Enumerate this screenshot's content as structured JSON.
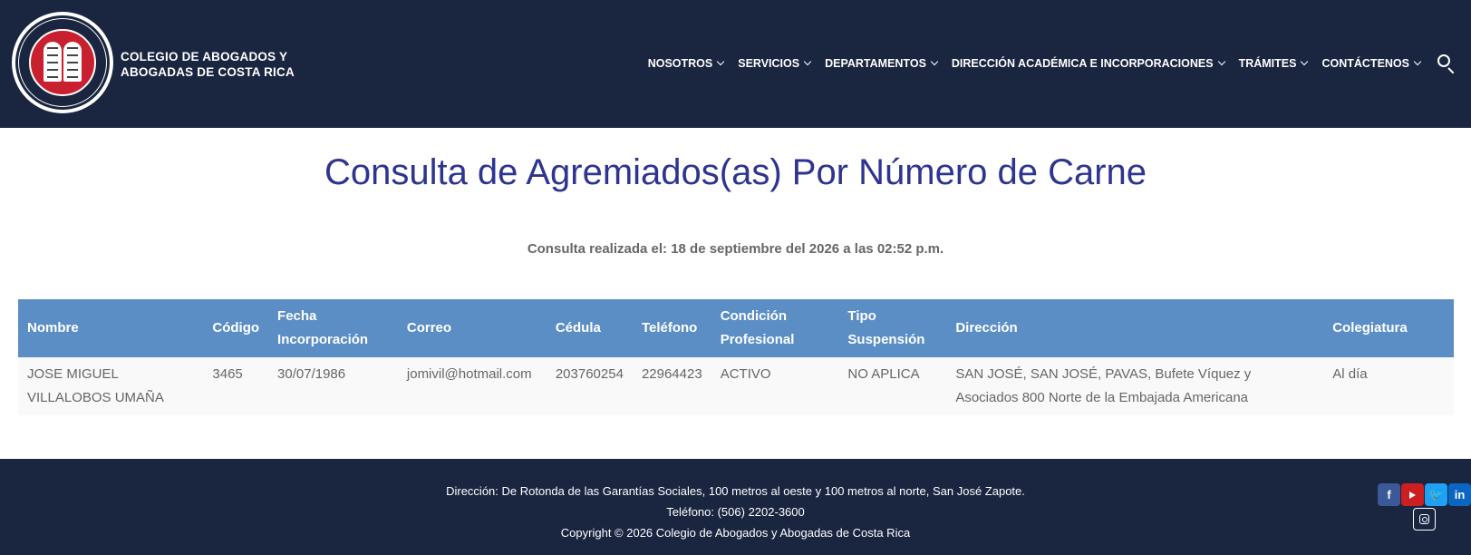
{
  "header": {
    "brand_line1": "COLEGIO DE ABOGADOS Y",
    "brand_line2": "ABOGADAS DE COSTA RICA",
    "logo_icon": "colegio-abogados-seal",
    "nav": [
      {
        "label": "NOSOTROS"
      },
      {
        "label": "SERVICIOS"
      },
      {
        "label": "DEPARTAMENTOS"
      },
      {
        "label": "DIRECCIÓN ACADÉMICA E INCORPORACIONES"
      },
      {
        "label": "TRÁMITES"
      },
      {
        "label": "CONTÁCTENOS"
      }
    ],
    "search_icon": "search-icon"
  },
  "main": {
    "title": "Consulta de Agremiados(as) Por Número de Carne",
    "query_info": "Consulta realizada el: 18 de septiembre del 2026 a las 02:52 p.m.",
    "table": {
      "headers": [
        "Nombre",
        "Código",
        "Fecha Incorporación",
        "Correo",
        "Cédula",
        "Teléfono",
        "Condición Profesional",
        "Tipo Suspensión",
        "Dirección",
        "Colegiatura"
      ],
      "rows": [
        [
          "JOSE MIGUEL VILLALOBOS UMAÑA",
          "3465",
          "30/07/1986",
          "jomivil@hotmail.com",
          "203760254",
          "22964423",
          "ACTIVO",
          "NO APLICA",
          "SAN JOSÉ, SAN JOSÉ, PAVAS, Bufete Víquez y Asociados 800 Norte de la Embajada Americana",
          "Al día"
        ]
      ]
    }
  },
  "footer": {
    "address": "Dirección: De Rotonda de las Garantías Sociales, 100 metros al oeste y 100 metros al norte, San José Zapote.",
    "phone": "Teléfono: (506) 2202-3600",
    "copyright": "Copyright © 2026 Colegio de Abogados y Abogadas de Costa Rica",
    "social": {
      "facebook": "f",
      "twitter": "🐦",
      "linkedin": "in"
    }
  },
  "colors": {
    "header_bg": "#1a2540",
    "title": "#2e3590",
    "table_header": "#5b8ec5",
    "accent_red": "#c8202e"
  }
}
